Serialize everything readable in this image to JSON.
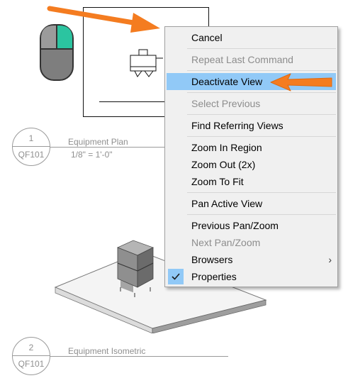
{
  "context_menu": {
    "items": [
      {
        "label": "Cancel",
        "enabled": true
      },
      {
        "label": "Repeat Last Command",
        "enabled": false
      },
      {
        "label": "Deactivate View",
        "enabled": true,
        "highlighted": true
      },
      {
        "label": "Select Previous",
        "enabled": false
      },
      {
        "label": "Find Referring Views",
        "enabled": true
      },
      {
        "label": "Zoom In Region",
        "enabled": true
      },
      {
        "label": "Zoom Out (2x)",
        "enabled": true
      },
      {
        "label": "Zoom To Fit",
        "enabled": true
      },
      {
        "label": "Pan Active View",
        "enabled": true
      },
      {
        "label": "Previous Pan/Zoom",
        "enabled": true
      },
      {
        "label": "Next Pan/Zoom",
        "enabled": false
      },
      {
        "label": "Browsers",
        "enabled": true,
        "submenu_indicator": "›"
      },
      {
        "label": "Properties",
        "enabled": true,
        "checked": true
      }
    ]
  },
  "views": [
    {
      "number": "1",
      "sheet": "QF101",
      "title": "Equipment Plan",
      "scale": "1/8\" = 1'-0\""
    },
    {
      "number": "2",
      "sheet": "QF101",
      "title": "Equipment Isometric"
    }
  ],
  "colors": {
    "accent_arrow": "#f47c20",
    "mouse_button": "#2bc4a0",
    "highlight": "#91c9f7"
  },
  "icons": [
    "mouse-right-click-icon",
    "pointer-arrow-icon",
    "checkmark-icon",
    "submenu-arrow-icon"
  ]
}
